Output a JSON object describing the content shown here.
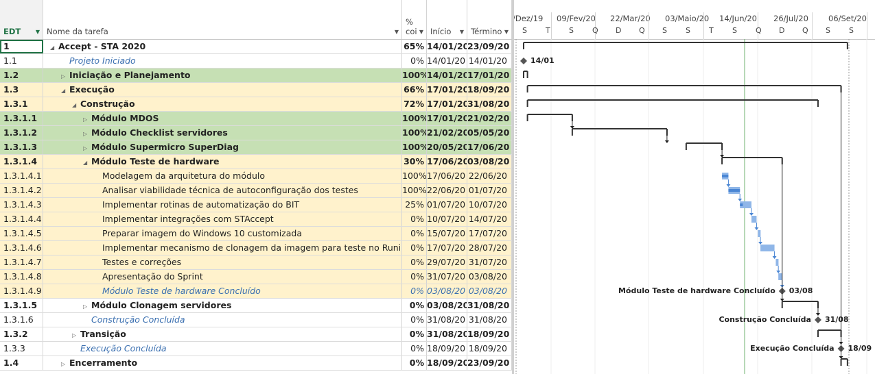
{
  "columns": {
    "edt": "EDT",
    "name": "Nome da tarefa",
    "pct_top": "%",
    "pct_bottom": "coi",
    "start": "Início",
    "end": "Término"
  },
  "timeline": {
    "top_labels": [
      "/Dez/19",
      "09/Fev/20",
      "22/Mar/20",
      "03/Maio/20",
      "14/Jun/20",
      "26/Jul/20",
      "06/Set/20"
    ],
    "day_labels": [
      "S",
      "T",
      "S",
      "Q",
      "D",
      "Q",
      "S",
      "S",
      "T",
      "S",
      "Q",
      "D",
      "Q",
      "S",
      "S"
    ]
  },
  "tasks": [
    {
      "edt": "1",
      "name": "Accept - STA 2020",
      "pct": "65%",
      "start": "14/01/20",
      "end": "23/09/20",
      "level": 0,
      "summary": true,
      "bg": "#ffffff",
      "toggle": "open"
    },
    {
      "edt": "1.1",
      "name": "Projeto Iniciado",
      "pct": "0%",
      "start": "14/01/20",
      "end": "14/01/20",
      "level": 1,
      "milestone": true,
      "bg": "#ffffff"
    },
    {
      "edt": "1.2",
      "name": "Iniciação e Planejamento",
      "pct": "100%",
      "start": "14/01/20",
      "end": "17/01/20",
      "level": 1,
      "summary": true,
      "bg": "#c6e0b4",
      "toggle": "closed"
    },
    {
      "edt": "1.3",
      "name": "Execução",
      "pct": "66%",
      "start": "17/01/20",
      "end": "18/09/20",
      "level": 1,
      "summary": true,
      "bg": "#fff2cc",
      "toggle": "open"
    },
    {
      "edt": "1.3.1",
      "name": "Construção",
      "pct": "72%",
      "start": "17/01/20",
      "end": "31/08/20",
      "level": 2,
      "summary": true,
      "bg": "#fff2cc",
      "toggle": "open"
    },
    {
      "edt": "1.3.1.1",
      "name": "Módulo MDOS",
      "pct": "100%",
      "start": "17/01/20",
      "end": "21/02/20",
      "level": 3,
      "summary": true,
      "bg": "#c6e0b4",
      "toggle": "closed"
    },
    {
      "edt": "1.3.1.2",
      "name": "Módulo Checklist servidores",
      "pct": "100%",
      "start": "21/02/20",
      "end": "05/05/20",
      "level": 3,
      "summary": true,
      "bg": "#c6e0b4",
      "toggle": "closed"
    },
    {
      "edt": "1.3.1.3",
      "name": "Módulo Supermicro SuperDiag",
      "pct": "100%",
      "start": "20/05/20",
      "end": "17/06/20",
      "level": 3,
      "summary": true,
      "bg": "#c6e0b4",
      "toggle": "closed"
    },
    {
      "edt": "1.3.1.4",
      "name": "Módulo Teste de hardware",
      "pct": "30%",
      "start": "17/06/20",
      "end": "03/08/20",
      "level": 3,
      "summary": true,
      "bg": "#fff2cc",
      "toggle": "open"
    },
    {
      "edt": "1.3.1.4.1",
      "name": "Modelagem da arquitetura do módulo",
      "pct": "100%",
      "start": "17/06/20",
      "end": "22/06/20",
      "level": 4,
      "bg": "#fff2cc"
    },
    {
      "edt": "1.3.1.4.2",
      "name": "Analisar viabilidade técnica de autoconfiguração dos testes",
      "pct": "100%",
      "start": "22/06/20",
      "end": "01/07/20",
      "level": 4,
      "bg": "#fff2cc"
    },
    {
      "edt": "1.3.1.4.3",
      "name": "Implementar rotinas de automatização do BIT",
      "pct": "25%",
      "start": "01/07/20",
      "end": "10/07/20",
      "level": 4,
      "bg": "#fff2cc"
    },
    {
      "edt": "1.3.1.4.4",
      "name": "Implementar integrações com STAccept",
      "pct": "0%",
      "start": "10/07/20",
      "end": "14/07/20",
      "level": 4,
      "bg": "#fff2cc"
    },
    {
      "edt": "1.3.1.4.5",
      "name": "Preparar imagem do Windows 10 customizada",
      "pct": "0%",
      "start": "15/07/20",
      "end": "17/07/20",
      "level": 4,
      "bg": "#fff2cc"
    },
    {
      "edt": "1.3.1.4.6",
      "name": "Implementar mecanismo de clonagem da imagem para teste no Runin",
      "pct": "0%",
      "start": "17/07/20",
      "end": "28/07/20",
      "level": 4,
      "bg": "#fff2cc"
    },
    {
      "edt": "1.3.1.4.7",
      "name": "Testes e correções",
      "pct": "0%",
      "start": "29/07/20",
      "end": "31/07/20",
      "level": 4,
      "bg": "#fff2cc"
    },
    {
      "edt": "1.3.1.4.8",
      "name": "Apresentação do Sprint",
      "pct": "0%",
      "start": "31/07/20",
      "end": "03/08/20",
      "level": 4,
      "bg": "#fff2cc"
    },
    {
      "edt": "1.3.1.4.9",
      "name": "Módulo Teste de hardware Concluído",
      "pct": "0%",
      "start": "03/08/20",
      "end": "03/08/20",
      "level": 4,
      "milestone": true,
      "bg": "#fff2cc"
    },
    {
      "edt": "1.3.1.5",
      "name": "Módulo Clonagem servidores",
      "pct": "0%",
      "start": "03/08/20",
      "end": "31/08/20",
      "level": 3,
      "summary": true,
      "bg": "#ffffff",
      "toggle": "closed"
    },
    {
      "edt": "1.3.1.6",
      "name": "Construção Concluída",
      "pct": "0%",
      "start": "31/08/20",
      "end": "31/08/20",
      "level": 3,
      "milestone": true,
      "bg": "#ffffff"
    },
    {
      "edt": "1.3.2",
      "name": "Transição",
      "pct": "0%",
      "start": "31/08/20",
      "end": "18/09/20",
      "level": 2,
      "summary": true,
      "bg": "#ffffff",
      "toggle": "closed"
    },
    {
      "edt": "1.3.3",
      "name": "Execução Concluída",
      "pct": "0%",
      "start": "18/09/20",
      "end": "18/09/20",
      "level": 2,
      "milestone": true,
      "bg": "#ffffff"
    },
    {
      "edt": "1.4",
      "name": "Encerramento",
      "pct": "0%",
      "start": "18/09/20",
      "end": "23/09/20",
      "level": 1,
      "summary": true,
      "bg": "#ffffff",
      "toggle": "closed"
    }
  ],
  "annotations": {
    "m1_date": "14/01",
    "m2_name": "Módulo Teste de hardware Concluído",
    "m2_date": "03/08",
    "m3_name": "Construção Concluída",
    "m3_date": "31/08",
    "m4_name": "Execução Concluída",
    "m4_date": "18/09"
  },
  "colors": {
    "done_bg": "#c6e0b4",
    "active_bg": "#fff2cc",
    "task_bar": "#8fb6e8",
    "progress": "#4a86d4",
    "link": "#4a86d4",
    "today_line": "#6fb06f"
  }
}
